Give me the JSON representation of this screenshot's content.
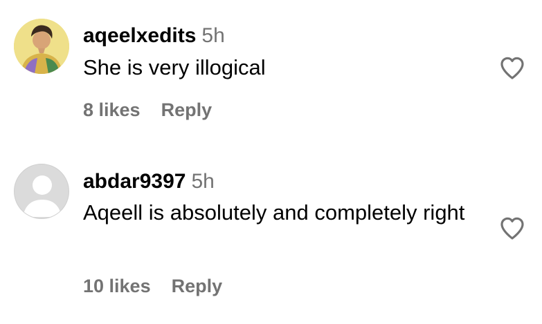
{
  "comments": [
    {
      "username": "aqeelxedits",
      "time": "5h",
      "text": "She is very illogical",
      "likes": "8 likes",
      "reply_label": "Reply",
      "avatar": "user-photo-avatar",
      "like_icon": "heart-outline-icon"
    },
    {
      "username": "abdar9397",
      "time": "5h",
      "text": "Aqeell is absolutely and completely right",
      "likes": "10 likes",
      "reply_label": "Reply",
      "avatar": "default-user-avatar",
      "like_icon": "heart-outline-icon"
    }
  ],
  "colors": {
    "text_primary": "#000000",
    "text_secondary": "#737373",
    "default_avatar": "#dbdbdb",
    "background": "#ffffff"
  }
}
